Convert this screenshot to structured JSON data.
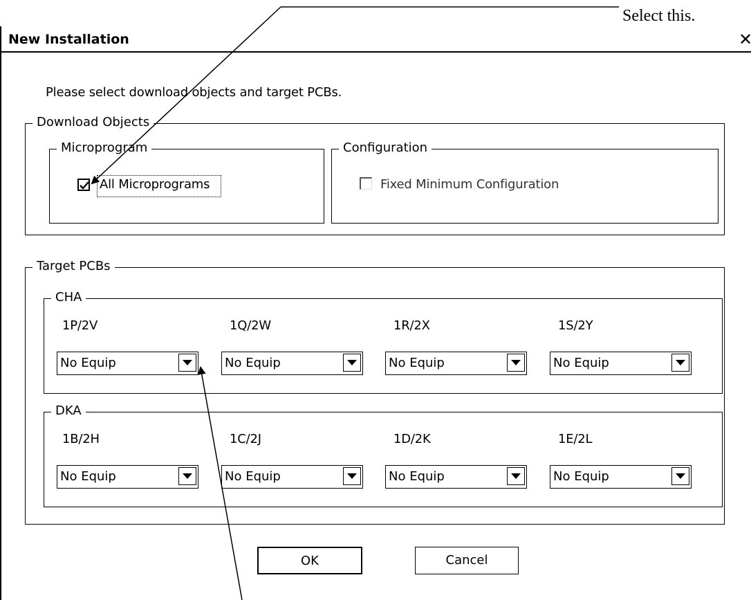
{
  "callout": {
    "text": "Select this."
  },
  "window": {
    "title": "New Installation",
    "close": "✕"
  },
  "intro": "Please select download objects and target PCBs.",
  "download_objects": {
    "legend": "Download Objects",
    "microprogram": {
      "legend": "Microprogram",
      "checkbox_label": "All Microprograms",
      "checked": true
    },
    "configuration": {
      "legend": "Configuration",
      "checkbox_label": "Fixed Minimum Configuration",
      "checked": false
    }
  },
  "target_pcbs": {
    "legend": "Target PCBs",
    "cha": {
      "legend": "CHA",
      "slots": [
        {
          "label": "1P/2V",
          "value": "No Equip"
        },
        {
          "label": "1Q/2W",
          "value": "No Equip"
        },
        {
          "label": "1R/2X",
          "value": "No Equip"
        },
        {
          "label": "1S/2Y",
          "value": "No Equip"
        }
      ]
    },
    "dka": {
      "legend": "DKA",
      "slots": [
        {
          "label": "1B/2H",
          "value": "No Equip"
        },
        {
          "label": "1C/2J",
          "value": "No Equip"
        },
        {
          "label": "1D/2K",
          "value": "No Equip"
        },
        {
          "label": "1E/2L",
          "value": "No Equip"
        }
      ]
    }
  },
  "buttons": {
    "ok": "OK",
    "cancel": "Cancel"
  },
  "icons": {
    "check": "check-icon",
    "dropdown": "chevron-down-icon",
    "close": "close-icon"
  }
}
